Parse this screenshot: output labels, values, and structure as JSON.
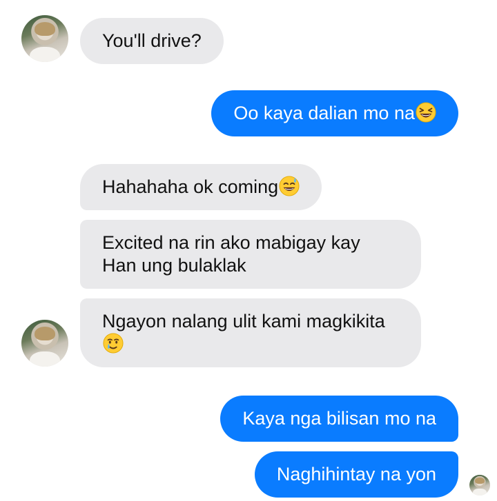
{
  "messages": [
    {
      "direction": "incoming",
      "text": "You'll drive?",
      "emoji": null
    },
    {
      "direction": "outgoing",
      "text": "Oo kaya dalian mo na",
      "emoji": "grinning-squinting-face"
    },
    {
      "direction": "incoming",
      "text": "Hahahaha ok coming",
      "emoji": "grinning-face-with-sweat"
    },
    {
      "direction": "incoming",
      "text": "Excited na rin ako mabigay kay Han ung bulaklak",
      "emoji": null
    },
    {
      "direction": "incoming",
      "text": "Ngayon nalang ulit kami magkikita",
      "emoji": "smiling-face-with-tear"
    },
    {
      "direction": "outgoing",
      "text": "Kaya nga bilisan mo na",
      "emoji": null
    },
    {
      "direction": "outgoing",
      "text": "Naghihintay na yon",
      "emoji": null
    }
  ],
  "colors": {
    "incoming_bubble": "#e9e9eb",
    "outgoing_bubble": "#0a7cff",
    "incoming_text": "#111111",
    "outgoing_text": "#ffffff"
  },
  "icons": [
    "contact-avatar",
    "read-receipt-avatar"
  ]
}
